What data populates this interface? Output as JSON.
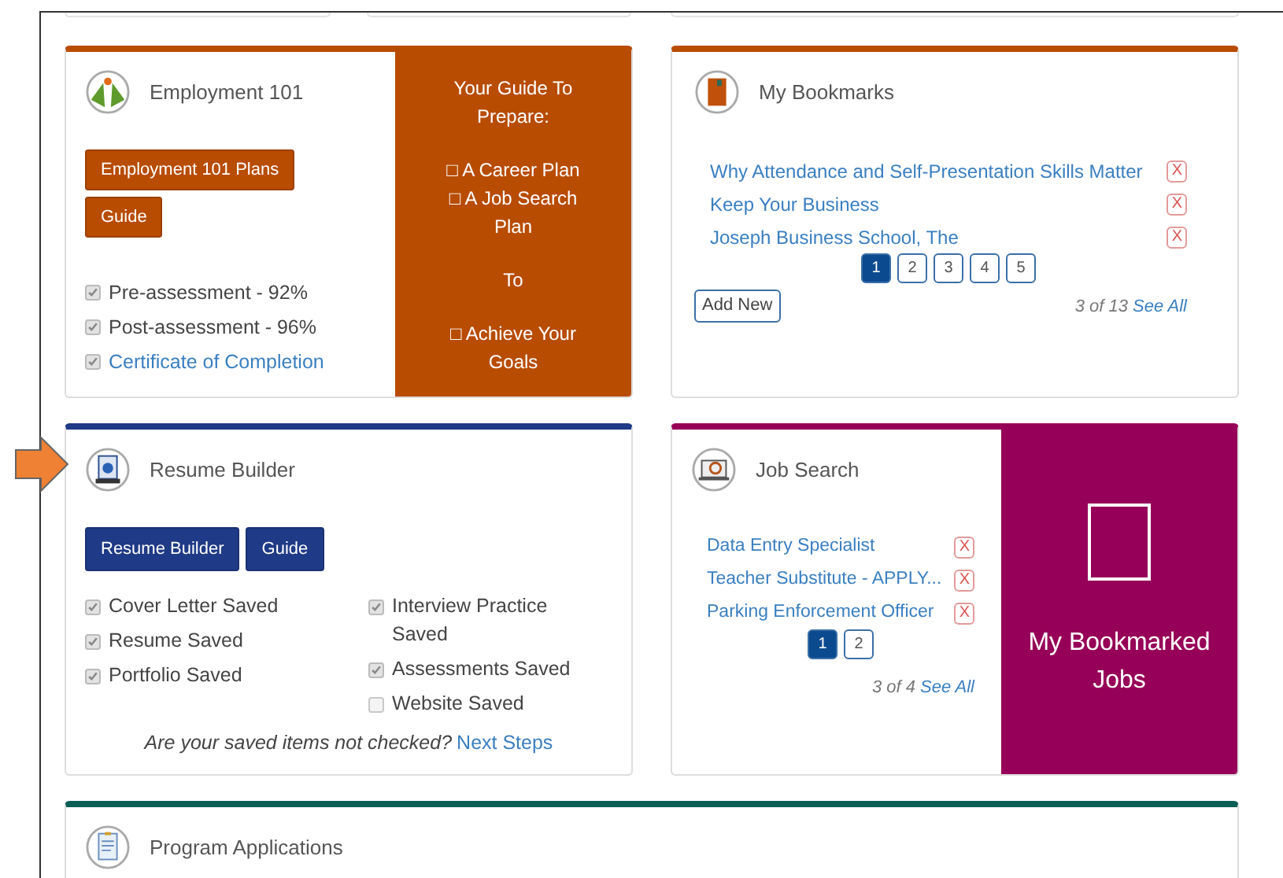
{
  "employment": {
    "title": "Employment 101",
    "buttons": [
      "Employment 101 Plans",
      "Guide"
    ],
    "checklist": [
      {
        "label": "Pre-assessment - 92%",
        "checked": true,
        "kind": "text"
      },
      {
        "label": "Post-assessment - 96%",
        "checked": true,
        "kind": "text"
      },
      {
        "label": "Certificate of Completion",
        "checked": true,
        "kind": "link"
      }
    ],
    "panel": [
      [
        "Your Guide To Prepare:"
      ],
      [
        "□ A Career Plan",
        "□ A Job Search Plan"
      ],
      [
        "To"
      ],
      [
        "□ Achieve Your Goals"
      ]
    ]
  },
  "bookmarks": {
    "title": "My Bookmarks",
    "items": [
      {
        "title": "Why Attendance and Self-Presentation Skills Matter",
        "remove": "X"
      },
      {
        "title": "Keep Your Business",
        "remove": "X"
      },
      {
        "title": "Joseph Business School, The",
        "remove": "X"
      }
    ],
    "pages": [
      {
        "label": "1",
        "selected": true
      },
      {
        "label": "2",
        "selected": false
      },
      {
        "label": "3",
        "selected": false
      },
      {
        "label": "4",
        "selected": false
      },
      {
        "label": "5",
        "selected": false
      }
    ],
    "add_button": "Add New",
    "count": "3 of 13",
    "see_all": "See All"
  },
  "resume": {
    "title": "Resume Builder",
    "buttons": [
      "Resume Builder",
      "Guide"
    ],
    "columns": [
      [
        {
          "label": "Cover Letter Saved",
          "checked": true
        },
        {
          "label": "Resume Saved",
          "checked": true
        },
        {
          "label": "Portfolio Saved",
          "checked": true
        }
      ],
      [
        {
          "label": "Interview Practice Saved",
          "checked": true
        },
        {
          "label": "Assessments Saved",
          "checked": true
        },
        {
          "label": "Website Saved",
          "checked": false
        }
      ]
    ],
    "question": "Are your saved items not checked?",
    "next_link": "Next Steps"
  },
  "job_search": {
    "title": "Job Search",
    "items": [
      {
        "title": "Data Entry Specialist",
        "remove": "X"
      },
      {
        "title": "Teacher Substitute - APPLY...",
        "remove": "X"
      },
      {
        "title": "Parking Enforcement Officer",
        "remove": "X"
      }
    ],
    "pages": [
      {
        "label": "1",
        "selected": true
      },
      {
        "label": "2",
        "selected": false
      }
    ],
    "count": "3 of 4",
    "see_all": "See All",
    "panel_title": "My Bookmarked Jobs"
  },
  "program_applications": {
    "title": "Program Applications"
  }
}
